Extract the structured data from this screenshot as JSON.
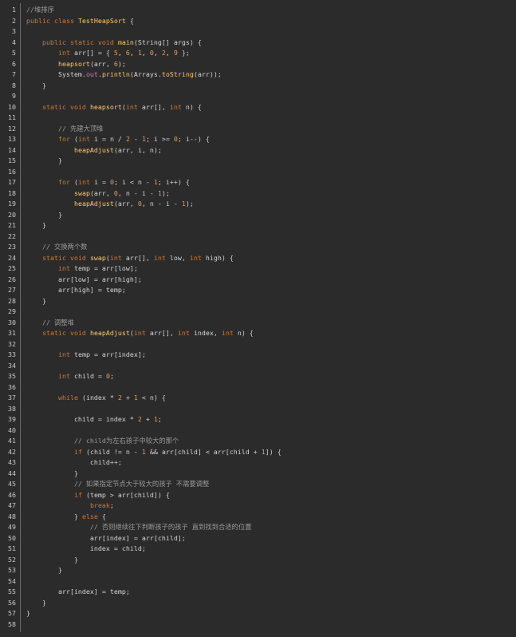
{
  "colors": {
    "background": "#2b2b2b",
    "gutter_text": "#c8c8c8",
    "keyword": "#cc7832",
    "function": "#ffc66d",
    "number": "#e59a5a",
    "comment": "#9a9a9a",
    "plain": "#d4d4d4"
  },
  "lines": [
    {
      "n": "1",
      "tokens": [
        {
          "t": "//堆排序",
          "c": "cm"
        }
      ]
    },
    {
      "n": "2",
      "tokens": [
        {
          "t": "public class ",
          "c": "kw"
        },
        {
          "t": "TestHeapSort",
          "c": "fn"
        },
        {
          "t": " {",
          "c": "txt"
        }
      ]
    },
    {
      "n": "3",
      "tokens": []
    },
    {
      "n": "4",
      "tokens": [
        {
          "t": "    ",
          "c": "txt"
        },
        {
          "t": "public static void ",
          "c": "kw"
        },
        {
          "t": "main",
          "c": "fn"
        },
        {
          "t": "(String[] args) {",
          "c": "txt"
        }
      ]
    },
    {
      "n": "5",
      "tokens": [
        {
          "t": "        ",
          "c": "txt"
        },
        {
          "t": "int",
          "c": "kw"
        },
        {
          "t": " arr[] = { ",
          "c": "txt"
        },
        {
          "t": "5",
          "c": "num"
        },
        {
          "t": ", ",
          "c": "txt"
        },
        {
          "t": "6",
          "c": "num"
        },
        {
          "t": ", ",
          "c": "txt"
        },
        {
          "t": "1",
          "c": "num"
        },
        {
          "t": ", ",
          "c": "txt"
        },
        {
          "t": "0",
          "c": "num"
        },
        {
          "t": ", ",
          "c": "txt"
        },
        {
          "t": "2",
          "c": "num"
        },
        {
          "t": ", ",
          "c": "txt"
        },
        {
          "t": "9",
          "c": "num"
        },
        {
          "t": " };",
          "c": "txt"
        }
      ]
    },
    {
      "n": "6",
      "tokens": [
        {
          "t": "        ",
          "c": "txt"
        },
        {
          "t": "heapsort",
          "c": "fn"
        },
        {
          "t": "(arr, ",
          "c": "txt"
        },
        {
          "t": "6",
          "c": "num"
        },
        {
          "t": ");",
          "c": "txt"
        }
      ]
    },
    {
      "n": "7",
      "tokens": [
        {
          "t": "        System.",
          "c": "txt"
        },
        {
          "t": "out",
          "c": "mem"
        },
        {
          "t": ".",
          "c": "txt"
        },
        {
          "t": "println",
          "c": "fn"
        },
        {
          "t": "(Arrays.",
          "c": "txt"
        },
        {
          "t": "toString",
          "c": "fn"
        },
        {
          "t": "(arr));",
          "c": "txt"
        }
      ]
    },
    {
      "n": "8",
      "tokens": [
        {
          "t": "    }",
          "c": "txt"
        }
      ]
    },
    {
      "n": "9",
      "tokens": []
    },
    {
      "n": "10",
      "tokens": [
        {
          "t": "    ",
          "c": "txt"
        },
        {
          "t": "static void ",
          "c": "kw"
        },
        {
          "t": "heapsort",
          "c": "fn"
        },
        {
          "t": "(",
          "c": "txt"
        },
        {
          "t": "int",
          "c": "kw"
        },
        {
          "t": " arr[], ",
          "c": "txt"
        },
        {
          "t": "int",
          "c": "kw"
        },
        {
          "t": " n) {",
          "c": "txt"
        }
      ]
    },
    {
      "n": "11",
      "tokens": []
    },
    {
      "n": "12",
      "tokens": [
        {
          "t": "        // 先建大顶堆",
          "c": "cm"
        }
      ]
    },
    {
      "n": "13",
      "tokens": [
        {
          "t": "        ",
          "c": "txt"
        },
        {
          "t": "for",
          "c": "kw"
        },
        {
          "t": " (",
          "c": "txt"
        },
        {
          "t": "int",
          "c": "kw"
        },
        {
          "t": " i = n / ",
          "c": "txt"
        },
        {
          "t": "2",
          "c": "num"
        },
        {
          "t": " - ",
          "c": "txt"
        },
        {
          "t": "1",
          "c": "num"
        },
        {
          "t": "; i >= ",
          "c": "txt"
        },
        {
          "t": "0",
          "c": "num"
        },
        {
          "t": "; i--) {",
          "c": "txt"
        }
      ]
    },
    {
      "n": "14",
      "tokens": [
        {
          "t": "            ",
          "c": "txt"
        },
        {
          "t": "heapAdjust",
          "c": "fn"
        },
        {
          "t": "(arr, i, n);",
          "c": "txt"
        }
      ]
    },
    {
      "n": "15",
      "tokens": [
        {
          "t": "        }",
          "c": "txt"
        }
      ]
    },
    {
      "n": "16",
      "tokens": []
    },
    {
      "n": "17",
      "tokens": [
        {
          "t": "        ",
          "c": "txt"
        },
        {
          "t": "for",
          "c": "kw"
        },
        {
          "t": " (",
          "c": "txt"
        },
        {
          "t": "int",
          "c": "kw"
        },
        {
          "t": " i = ",
          "c": "txt"
        },
        {
          "t": "0",
          "c": "num"
        },
        {
          "t": "; i < n - ",
          "c": "txt"
        },
        {
          "t": "1",
          "c": "num"
        },
        {
          "t": "; i++) {",
          "c": "txt"
        }
      ]
    },
    {
      "n": "18",
      "tokens": [
        {
          "t": "            ",
          "c": "txt"
        },
        {
          "t": "swap",
          "c": "fn"
        },
        {
          "t": "(arr, ",
          "c": "txt"
        },
        {
          "t": "0",
          "c": "num"
        },
        {
          "t": ", n - i - ",
          "c": "txt"
        },
        {
          "t": "1",
          "c": "num"
        },
        {
          "t": ");",
          "c": "txt"
        }
      ]
    },
    {
      "n": "19",
      "tokens": [
        {
          "t": "            ",
          "c": "txt"
        },
        {
          "t": "heapAdjust",
          "c": "fn"
        },
        {
          "t": "(arr, ",
          "c": "txt"
        },
        {
          "t": "0",
          "c": "num"
        },
        {
          "t": ", n - i - ",
          "c": "txt"
        },
        {
          "t": "1",
          "c": "num"
        },
        {
          "t": ");",
          "c": "txt"
        }
      ]
    },
    {
      "n": "20",
      "tokens": [
        {
          "t": "        }",
          "c": "txt"
        }
      ]
    },
    {
      "n": "21",
      "tokens": [
        {
          "t": "    }",
          "c": "txt"
        }
      ]
    },
    {
      "n": "22",
      "tokens": []
    },
    {
      "n": "23",
      "tokens": [
        {
          "t": "    // 交换两个数",
          "c": "cm"
        }
      ]
    },
    {
      "n": "24",
      "tokens": [
        {
          "t": "    ",
          "c": "txt"
        },
        {
          "t": "static void ",
          "c": "kw"
        },
        {
          "t": "swap",
          "c": "fn"
        },
        {
          "t": "(",
          "c": "txt"
        },
        {
          "t": "int",
          "c": "kw"
        },
        {
          "t": " arr[], ",
          "c": "txt"
        },
        {
          "t": "int",
          "c": "kw"
        },
        {
          "t": " low, ",
          "c": "txt"
        },
        {
          "t": "int",
          "c": "kw"
        },
        {
          "t": " high) {",
          "c": "txt"
        }
      ]
    },
    {
      "n": "25",
      "tokens": [
        {
          "t": "        ",
          "c": "txt"
        },
        {
          "t": "int",
          "c": "kw"
        },
        {
          "t": " temp = arr[low];",
          "c": "txt"
        }
      ]
    },
    {
      "n": "26",
      "tokens": [
        {
          "t": "        arr[low] = arr[high];",
          "c": "txt"
        }
      ]
    },
    {
      "n": "27",
      "tokens": [
        {
          "t": "        arr[high] = temp;",
          "c": "txt"
        }
      ]
    },
    {
      "n": "28",
      "tokens": [
        {
          "t": "    }",
          "c": "txt"
        }
      ]
    },
    {
      "n": "29",
      "tokens": []
    },
    {
      "n": "30",
      "tokens": [
        {
          "t": "    // 调整堆",
          "c": "cm"
        }
      ]
    },
    {
      "n": "31",
      "tokens": [
        {
          "t": "    ",
          "c": "txt"
        },
        {
          "t": "static void ",
          "c": "kw"
        },
        {
          "t": "heapAdjust",
          "c": "fn"
        },
        {
          "t": "(",
          "c": "txt"
        },
        {
          "t": "int",
          "c": "kw"
        },
        {
          "t": " arr[], ",
          "c": "txt"
        },
        {
          "t": "int",
          "c": "kw"
        },
        {
          "t": " index, ",
          "c": "txt"
        },
        {
          "t": "int",
          "c": "kw"
        },
        {
          "t": " n) {",
          "c": "txt"
        }
      ]
    },
    {
      "n": "32",
      "tokens": []
    },
    {
      "n": "33",
      "tokens": [
        {
          "t": "        ",
          "c": "txt"
        },
        {
          "t": "int",
          "c": "kw"
        },
        {
          "t": " temp = arr[index];",
          "c": "txt"
        }
      ]
    },
    {
      "n": "34",
      "tokens": []
    },
    {
      "n": "35",
      "tokens": [
        {
          "t": "        ",
          "c": "txt"
        },
        {
          "t": "int",
          "c": "kw"
        },
        {
          "t": " child = ",
          "c": "txt"
        },
        {
          "t": "0",
          "c": "num"
        },
        {
          "t": ";",
          "c": "txt"
        }
      ]
    },
    {
      "n": "36",
      "tokens": []
    },
    {
      "n": "37",
      "tokens": [
        {
          "t": "        ",
          "c": "txt"
        },
        {
          "t": "while",
          "c": "kw"
        },
        {
          "t": " (index * ",
          "c": "txt"
        },
        {
          "t": "2",
          "c": "num"
        },
        {
          "t": " + ",
          "c": "txt"
        },
        {
          "t": "1",
          "c": "num"
        },
        {
          "t": " < n) {",
          "c": "txt"
        }
      ]
    },
    {
      "n": "38",
      "tokens": []
    },
    {
      "n": "39",
      "tokens": [
        {
          "t": "            child = index * ",
          "c": "txt"
        },
        {
          "t": "2",
          "c": "num"
        },
        {
          "t": " + ",
          "c": "txt"
        },
        {
          "t": "1",
          "c": "num"
        },
        {
          "t": ";",
          "c": "txt"
        }
      ]
    },
    {
      "n": "40",
      "tokens": []
    },
    {
      "n": "41",
      "tokens": [
        {
          "t": "            // child为左右孩子中较大的那个",
          "c": "cm"
        }
      ]
    },
    {
      "n": "42",
      "tokens": [
        {
          "t": "            ",
          "c": "txt"
        },
        {
          "t": "if",
          "c": "kw"
        },
        {
          "t": " (child != n - ",
          "c": "txt"
        },
        {
          "t": "1",
          "c": "num"
        },
        {
          "t": " && arr[child] < arr[child + ",
          "c": "txt"
        },
        {
          "t": "1",
          "c": "num"
        },
        {
          "t": "]) {",
          "c": "txt"
        }
      ]
    },
    {
      "n": "43",
      "tokens": [
        {
          "t": "                child++;",
          "c": "txt"
        }
      ]
    },
    {
      "n": "44",
      "tokens": [
        {
          "t": "            }",
          "c": "txt"
        }
      ]
    },
    {
      "n": "45",
      "tokens": [
        {
          "t": "            // 如果指定节点大于较大的孩子 不需要调整",
          "c": "cm"
        }
      ]
    },
    {
      "n": "46",
      "tokens": [
        {
          "t": "            ",
          "c": "txt"
        },
        {
          "t": "if",
          "c": "kw"
        },
        {
          "t": " (temp > arr[child]) {",
          "c": "txt"
        }
      ]
    },
    {
      "n": "47",
      "tokens": [
        {
          "t": "                ",
          "c": "txt"
        },
        {
          "t": "break",
          "c": "kw"
        },
        {
          "t": ";",
          "c": "txt"
        }
      ]
    },
    {
      "n": "48",
      "tokens": [
        {
          "t": "            } ",
          "c": "txt"
        },
        {
          "t": "else",
          "c": "kw"
        },
        {
          "t": " {",
          "c": "txt"
        }
      ]
    },
    {
      "n": "49",
      "tokens": [
        {
          "t": "                // 否则继续往下判断孩子的孩子 直到找到合适的位置",
          "c": "cm"
        }
      ]
    },
    {
      "n": "50",
      "tokens": [
        {
          "t": "                arr[index] = arr[child];",
          "c": "txt"
        }
      ]
    },
    {
      "n": "51",
      "tokens": [
        {
          "t": "                index = child;",
          "c": "txt"
        }
      ]
    },
    {
      "n": "52",
      "tokens": [
        {
          "t": "            }",
          "c": "txt"
        }
      ]
    },
    {
      "n": "53",
      "tokens": [
        {
          "t": "        }",
          "c": "txt"
        }
      ]
    },
    {
      "n": "54",
      "tokens": []
    },
    {
      "n": "55",
      "tokens": [
        {
          "t": "        arr[index] = temp;",
          "c": "txt"
        }
      ]
    },
    {
      "n": "56",
      "tokens": [
        {
          "t": "    }",
          "c": "txt"
        }
      ]
    },
    {
      "n": "57",
      "tokens": [
        {
          "t": "}",
          "c": "txt"
        }
      ]
    },
    {
      "n": "58",
      "tokens": []
    }
  ]
}
